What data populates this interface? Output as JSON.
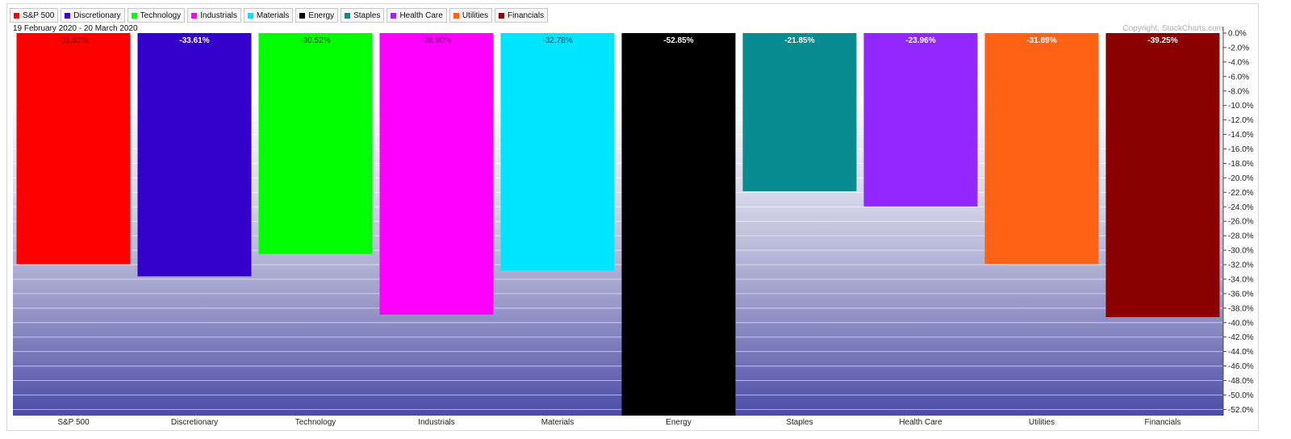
{
  "header": {
    "date_range": "19 February 2020 - 20 March 2020",
    "copyright": "Copyright, StockCharts.com"
  },
  "legend": [
    {
      "label": "S&P 500",
      "color": "#ff0000"
    },
    {
      "label": "Discretionary",
      "color": "#3300cc"
    },
    {
      "label": "Technology",
      "color": "#00ff00"
    },
    {
      "label": "Industrials",
      "color": "#ff00ff"
    },
    {
      "label": "Materials",
      "color": "#00e5ff"
    },
    {
      "label": "Energy",
      "color": "#000000"
    },
    {
      "label": "Staples",
      "color": "#088c8f"
    },
    {
      "label": "Health Care",
      "color": "#9228ff"
    },
    {
      "label": "Utilities",
      "color": "#ff6117"
    },
    {
      "label": "Financials",
      "color": "#8b0000"
    }
  ],
  "chart_data": {
    "type": "bar",
    "categories": [
      "S&P 500",
      "Discretionary",
      "Technology",
      "Industrials",
      "Materials",
      "Energy",
      "Staples",
      "Health Care",
      "Utilities",
      "Financials"
    ],
    "values": [
      -31.93,
      -33.61,
      -30.52,
      -38.9,
      -32.78,
      -52.85,
      -21.85,
      -23.96,
      -31.89,
      -39.25
    ],
    "labels": [
      "-31.93%",
      "-33.61%",
      "-30.52%",
      "-38.90%",
      "-32.78%",
      "-52.85%",
      "-21.85%",
      "-23.96%",
      "-31.89%",
      "-39.25%"
    ],
    "colors": [
      "#ff0000",
      "#3300cc",
      "#00ff00",
      "#ff00ff",
      "#00e5ff",
      "#000000",
      "#088c8f",
      "#9228ff",
      "#ff6117",
      "#8b0000"
    ],
    "label_colors": [
      "#7a0000",
      "#ffffff",
      "#004d00",
      "#800080",
      "#004a55",
      "#ffffff",
      "#ffffff",
      "#ffffff",
      "#ffffff",
      "#ffffff"
    ],
    "yticks": [
      "0.0%",
      "-2.0%",
      "-4.0%",
      "-6.0%",
      "-8.0%",
      "-10.0%",
      "-12.0%",
      "-14.0%",
      "-16.0%",
      "-18.0%",
      "-20.0%",
      "-22.0%",
      "-24.0%",
      "-26.0%",
      "-28.0%",
      "-30.0%",
      "-32.0%",
      "-34.0%",
      "-36.0%",
      "-38.0%",
      "-40.0%",
      "-42.0%",
      "-44.0%",
      "-46.0%",
      "-48.0%",
      "-50.0%",
      "-52.0%"
    ],
    "ylim": [
      -52.85,
      0
    ],
    "y_axis_position": "right",
    "grid": true
  }
}
